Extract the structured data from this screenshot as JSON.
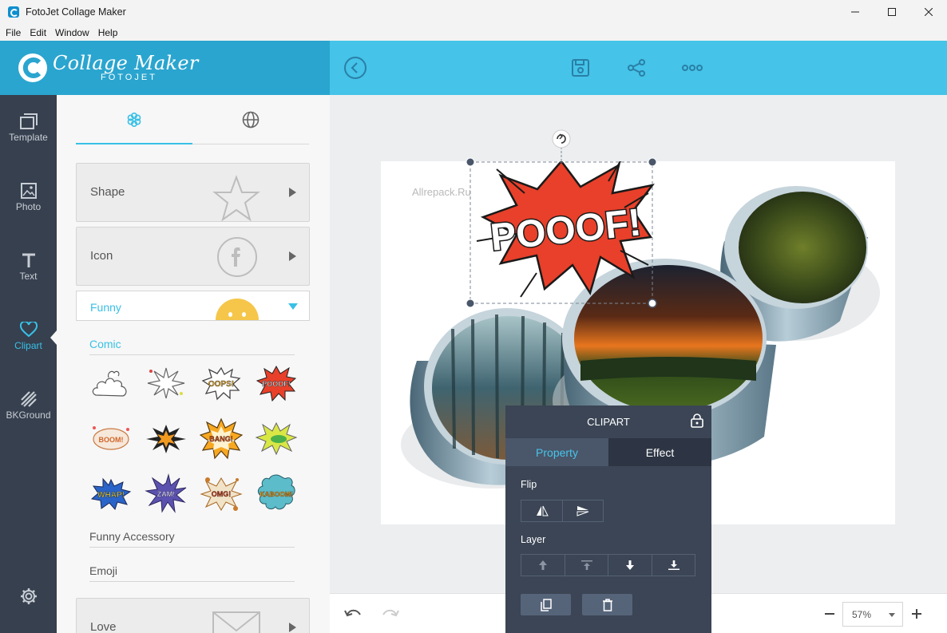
{
  "window": {
    "title": "FotoJet Collage Maker",
    "controls": [
      "minimize-icon",
      "maximize-icon",
      "close-icon"
    ]
  },
  "menu": [
    "File",
    "Edit",
    "Window",
    "Help"
  ],
  "brand": {
    "title": "Collage Maker",
    "subtitle": "FOTOJET"
  },
  "toolbar": {
    "icons": [
      "back-icon",
      "save-icon",
      "share-icon",
      "more-icon"
    ]
  },
  "nav": [
    {
      "label": "Template",
      "icon": "template-icon"
    },
    {
      "label": "Photo",
      "icon": "photo-icon"
    },
    {
      "label": "Text",
      "icon": "text-icon"
    },
    {
      "label": "Clipart",
      "icon": "heart-icon",
      "active": true
    },
    {
      "label": "BKGround",
      "icon": "background-icon"
    }
  ],
  "panel": {
    "tabs": [
      "snowflake-icon",
      "globe-icon"
    ],
    "categories": {
      "shape": "Shape",
      "icon": "Icon",
      "love": "Love"
    },
    "dropdown": {
      "selected": "Funny"
    },
    "subcategories": {
      "comic": "Comic",
      "accessory": "Funny Accessory",
      "emoji": "Emoji"
    },
    "comic_items": [
      {
        "text": ""
      },
      {
        "text": ""
      },
      {
        "text": "OOPS!"
      },
      {
        "text": "POOOF!"
      },
      {
        "text": "BOOM!"
      },
      {
        "text": ""
      },
      {
        "text": "BANG!"
      },
      {
        "text": ""
      },
      {
        "text": "WHAP!"
      },
      {
        "text": "ZAM!"
      },
      {
        "text": "OMG!"
      },
      {
        "text": "KABOOM!"
      }
    ]
  },
  "canvas": {
    "watermark": "Allrepack.Ru",
    "clipart_text": "POOOF!"
  },
  "popup": {
    "title": "CLIPART",
    "tabs": {
      "property": "Property",
      "effect": "Effect"
    },
    "flip_label": "Flip",
    "layer_label": "Layer"
  },
  "bottom": {
    "zoom": "57%"
  },
  "colors": {
    "accent": "#45c3e8",
    "nav_bg": "#36404f",
    "popup_bg": "#3b4555"
  }
}
